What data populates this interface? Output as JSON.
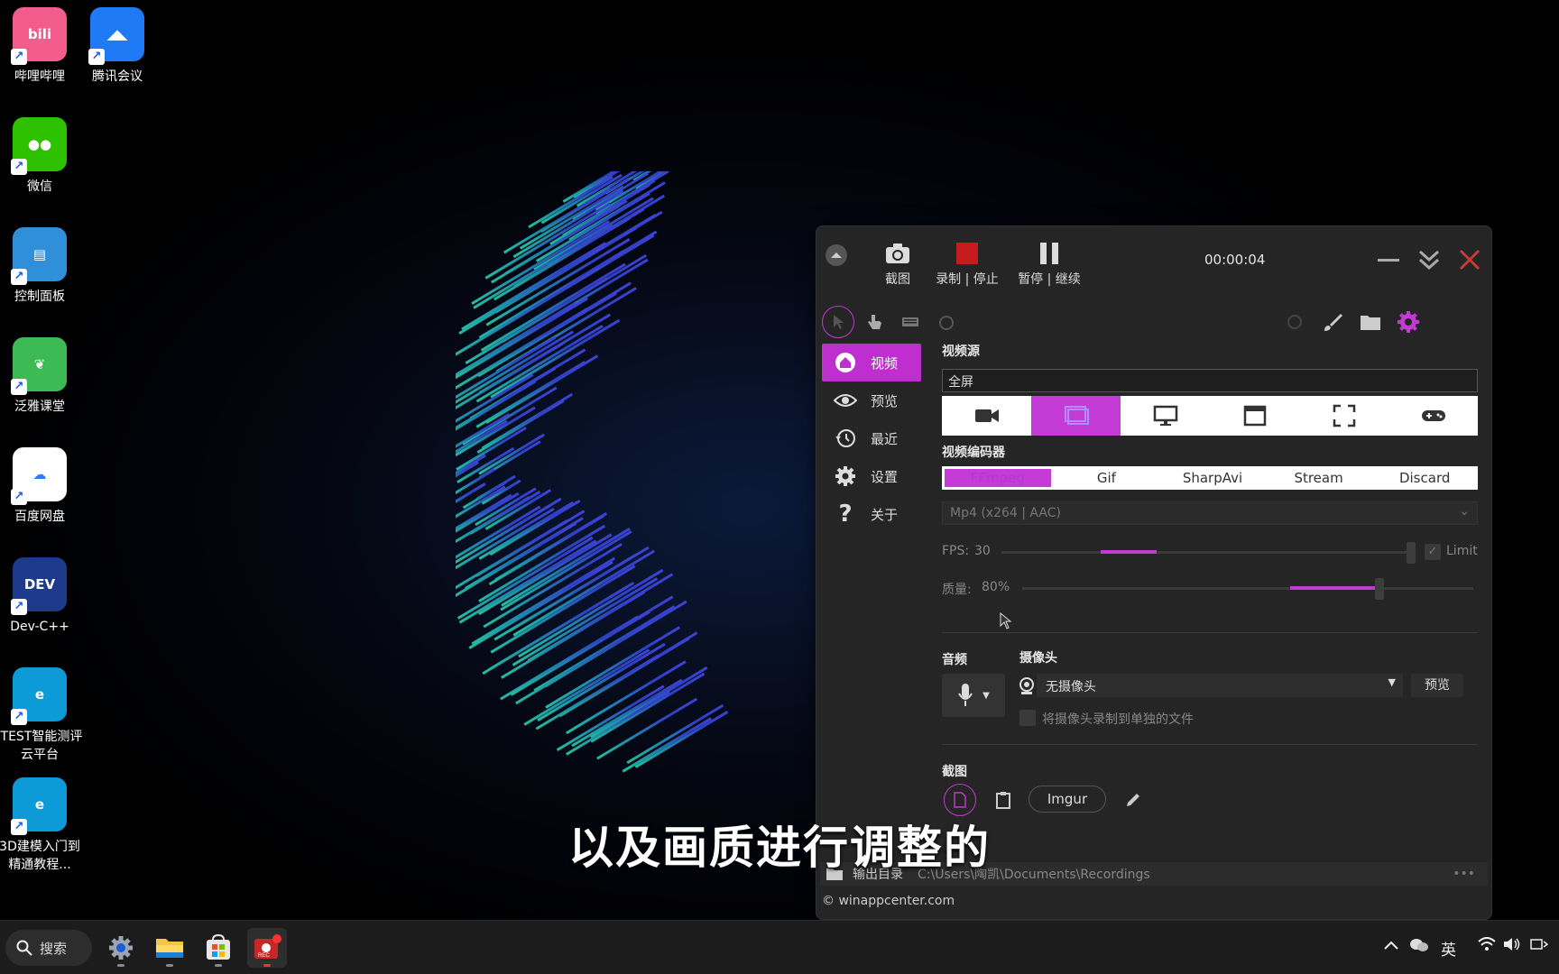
{
  "desktop": {
    "icons": [
      {
        "label": "哔哩哔哩",
        "icon": "bilibili-icon",
        "color": "#f25d8e"
      },
      {
        "label": "腾讯会议",
        "icon": "tencent-meeting-icon",
        "color": "#1f7bf5"
      },
      {
        "label": "微信",
        "icon": "wechat-icon",
        "color": "#2dc100"
      },
      {
        "label": "控制面板",
        "icon": "control-panel-icon",
        "color": "#2f8fd8"
      },
      {
        "label": "泛雅课堂",
        "icon": "fanya-icon",
        "color": "#3cba54"
      },
      {
        "label": "百度网盘",
        "icon": "baidu-netdisk-icon",
        "color": "#ffffff"
      },
      {
        "label": "Dev-C++",
        "icon": "devcpp-icon",
        "color": "#1e3a8a"
      },
      {
        "label": "iTEST智能测评云平台",
        "icon": "edge-icon",
        "color": "#0c9bd6"
      },
      {
        "label": "3D建模入门到精通教程...",
        "icon": "edge-icon",
        "color": "#0c9bd6"
      }
    ],
    "subtitle": "以及画质进行调整的"
  },
  "window": {
    "toolbar": {
      "screenshot_label": "截图",
      "record_label": "录制 | 停止",
      "pause_label": "暂停 | 继续",
      "timer": "00:00:04"
    },
    "sidebar": {
      "items": [
        {
          "label": "视频",
          "icon": "home-icon",
          "active": true
        },
        {
          "label": "预览",
          "icon": "eye-icon"
        },
        {
          "label": "最近",
          "icon": "history-icon"
        },
        {
          "label": "设置",
          "icon": "gear-icon"
        },
        {
          "label": "关于",
          "icon": "question-icon"
        }
      ]
    },
    "video_source": {
      "title": "视频源",
      "value": "全屏",
      "options": [
        "webcam",
        "region",
        "screen",
        "window",
        "fullscreen",
        "game"
      ],
      "selected_index": 1
    },
    "encoder": {
      "title": "视频编码器",
      "tabs": [
        "FFmpeg",
        "Gif",
        "SharpAvi",
        "Stream",
        "Discard"
      ],
      "selected_index": 0,
      "format": "Mp4 (x264 | AAC)",
      "fps_label": "FPS:",
      "fps_value": "30",
      "limit_label": "Limit",
      "quality_label": "质量:",
      "quality_value": "80%"
    },
    "audio": {
      "title": "音频"
    },
    "webcam": {
      "title": "摄像头",
      "value": "无摄像头",
      "preview_label": "预览",
      "separate_file_label": "将摄像头录制到单独的文件"
    },
    "screenshot": {
      "title": "截图",
      "imgur_label": "Imgur"
    },
    "output": {
      "label": "输出目录",
      "path": "C:\\Users\\陶凯\\Documents\\Recordings",
      "more": "•••"
    },
    "copyright": "© winappcenter.com",
    "accent_color": "#c13ad1"
  },
  "taskbar": {
    "search_label": "搜索",
    "ime_label": "英"
  }
}
